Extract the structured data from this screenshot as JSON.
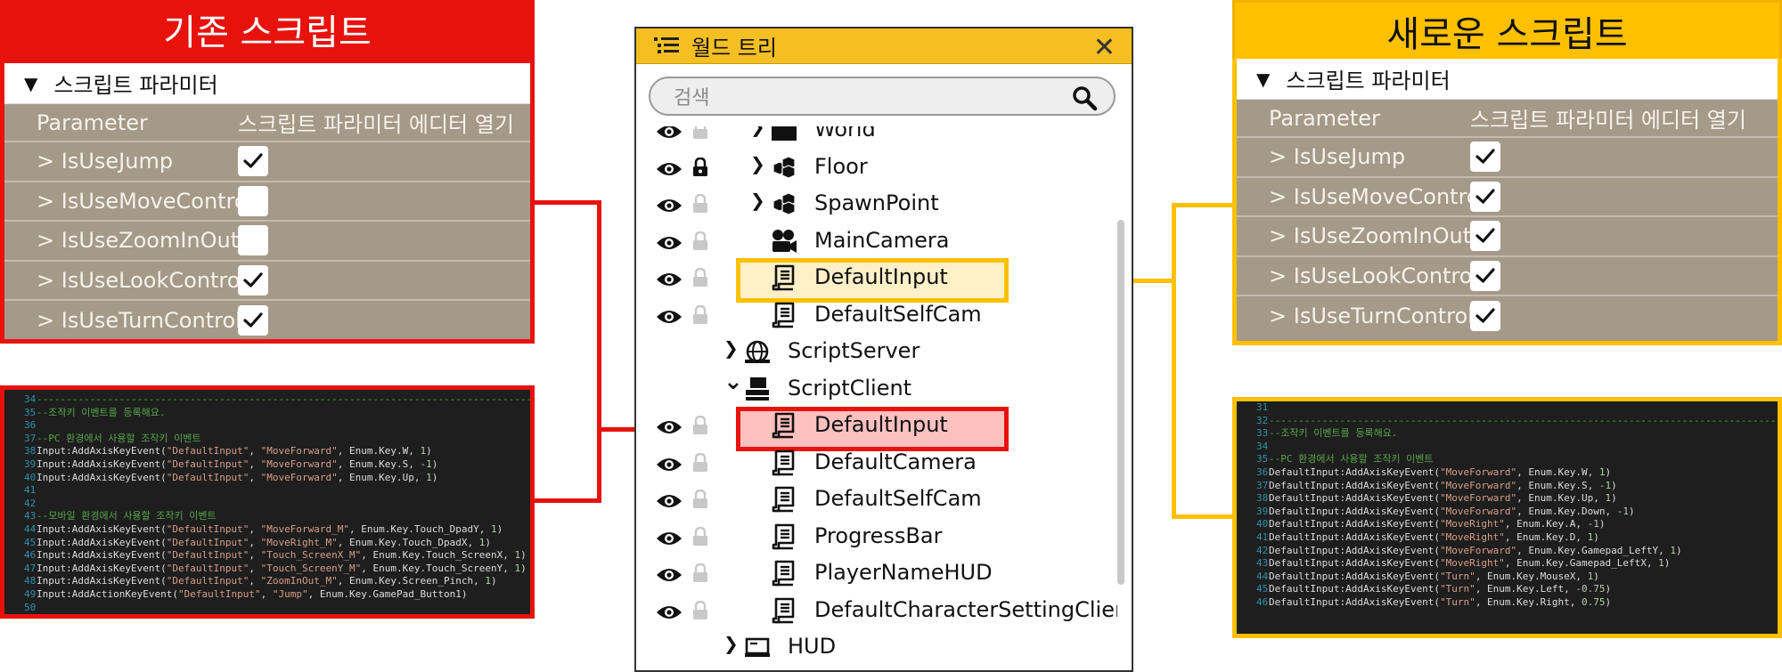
{
  "colors": {
    "old_accent": "#e8120c",
    "new_accent": "#ffc000",
    "panel_bg": "#a5998a",
    "code_bg": "#1e1e1e"
  },
  "old_section": {
    "banner": "기존 스크립트",
    "header": "스크립트 파라미터",
    "col_param": "Parameter",
    "col_editor": "스크립트 파라미터 에디터 열기",
    "params": [
      {
        "name": "> IsUseJump",
        "checked": true
      },
      {
        "name": "> IsUseMoveControl",
        "checked": false
      },
      {
        "name": "> IsUseZoomInOut",
        "checked": false
      },
      {
        "name": "> IsUseLookControl",
        "checked": true
      },
      {
        "name": "> IsUseTurnControl",
        "checked": true
      }
    ]
  },
  "new_section": {
    "banner": "새로운 스크립트",
    "header": "스크립트 파라미터",
    "col_param": "Parameter",
    "col_editor": "스크립트 파라미터 에디터 열기",
    "params": [
      {
        "name": "> IsUseJump",
        "checked": true
      },
      {
        "name": "> IsUseMoveControl",
        "checked": true
      },
      {
        "name": "> IsUseZoomInOut",
        "checked": true
      },
      {
        "name": "> IsUseLookControl",
        "checked": true
      },
      {
        "name": "> IsUseTurnControl",
        "checked": true
      }
    ]
  },
  "old_code": [
    {
      "n": "34",
      "parts": [
        [
          "cm",
          "-----------------------------------------------------------------------------------------"
        ]
      ]
    },
    {
      "n": "35",
      "parts": [
        [
          "cm",
          "--조작키 이벤트를 등록해요."
        ]
      ]
    },
    {
      "n": "36",
      "parts": []
    },
    {
      "n": "37",
      "parts": [
        [
          "cm",
          "--PC 환경에서 사용할 조작키 이벤트"
        ]
      ]
    },
    {
      "n": "38",
      "parts": [
        [
          "tx",
          "Input:AddAxisKeyEvent("
        ],
        [
          "st",
          "\"DefaultInput\""
        ],
        [
          "tx",
          ", "
        ],
        [
          "st",
          "\"MoveForward\""
        ],
        [
          "tx",
          ", Enum.Key.W, "
        ],
        [
          "nm",
          "1"
        ],
        [
          "tx",
          ")"
        ]
      ]
    },
    {
      "n": "39",
      "parts": [
        [
          "tx",
          "Input:AddAxisKeyEvent("
        ],
        [
          "st",
          "\"DefaultInput\""
        ],
        [
          "tx",
          ", "
        ],
        [
          "st",
          "\"MoveForward\""
        ],
        [
          "tx",
          ", Enum.Key.S, "
        ],
        [
          "nm",
          "-1"
        ],
        [
          "tx",
          ")"
        ]
      ]
    },
    {
      "n": "40",
      "parts": [
        [
          "tx",
          "Input:AddAxisKeyEvent("
        ],
        [
          "st",
          "\"DefaultInput\""
        ],
        [
          "tx",
          ", "
        ],
        [
          "st",
          "\"MoveForward\""
        ],
        [
          "tx",
          ", Enum.Key.Up, "
        ],
        [
          "nm",
          "1"
        ],
        [
          "tx",
          ")"
        ]
      ]
    },
    {
      "n": "41",
      "parts": []
    },
    {
      "n": "42",
      "parts": []
    },
    {
      "n": "43",
      "parts": [
        [
          "cm",
          "--모바일 환경에서 사용할 조작키 이벤트"
        ]
      ]
    },
    {
      "n": "44",
      "parts": [
        [
          "tx",
          "Input:AddAxisKeyEvent("
        ],
        [
          "st",
          "\"DefaultInput\""
        ],
        [
          "tx",
          ", "
        ],
        [
          "st",
          "\"MoveForward_M\""
        ],
        [
          "tx",
          ", Enum.Key.Touch_DpadY, "
        ],
        [
          "nm",
          "1"
        ],
        [
          "tx",
          ")"
        ]
      ]
    },
    {
      "n": "45",
      "parts": [
        [
          "tx",
          "Input:AddAxisKeyEvent("
        ],
        [
          "st",
          "\"DefaultInput\""
        ],
        [
          "tx",
          ", "
        ],
        [
          "st",
          "\"MoveRight_M\""
        ],
        [
          "tx",
          ", Enum.Key.Touch_DpadX, "
        ],
        [
          "nm",
          "1"
        ],
        [
          "tx",
          ")"
        ]
      ]
    },
    {
      "n": "46",
      "parts": [
        [
          "tx",
          "Input:AddAxisKeyEvent("
        ],
        [
          "st",
          "\"DefaultInput\""
        ],
        [
          "tx",
          ", "
        ],
        [
          "st",
          "\"Touch_ScreenX_M\""
        ],
        [
          "tx",
          ", Enum.Key.Touch_ScreenX, "
        ],
        [
          "nm",
          "1"
        ],
        [
          "tx",
          ")"
        ]
      ]
    },
    {
      "n": "47",
      "parts": [
        [
          "tx",
          "Input:AddAxisKeyEvent("
        ],
        [
          "st",
          "\"DefaultInput\""
        ],
        [
          "tx",
          ", "
        ],
        [
          "st",
          "\"Touch_ScreenY_M\""
        ],
        [
          "tx",
          ", Enum.Key.Touch_ScreenY, "
        ],
        [
          "nm",
          "1"
        ],
        [
          "tx",
          ")"
        ]
      ]
    },
    {
      "n": "48",
      "parts": [
        [
          "tx",
          "Input:AddAxisKeyEvent("
        ],
        [
          "st",
          "\"DefaultInput\""
        ],
        [
          "tx",
          ", "
        ],
        [
          "st",
          "\"ZoomInOut_M\""
        ],
        [
          "tx",
          ", Enum.Key.Screen_Pinch, "
        ],
        [
          "nm",
          "1"
        ],
        [
          "tx",
          ")"
        ]
      ]
    },
    {
      "n": "49",
      "parts": [
        [
          "tx",
          "Input:AddActionKeyEvent("
        ],
        [
          "st",
          "\"DefaultInput\""
        ],
        [
          "tx",
          ", "
        ],
        [
          "st",
          "\"Jump\""
        ],
        [
          "tx",
          ", Enum.Key.GamePad_Button1)"
        ]
      ]
    },
    {
      "n": "50",
      "parts": []
    }
  ],
  "new_code": [
    {
      "n": "31",
      "parts": []
    },
    {
      "n": "32",
      "parts": [
        [
          "cm",
          "-----------------------------------------------------------------------------------------"
        ]
      ]
    },
    {
      "n": "33",
      "parts": [
        [
          "cm",
          "--조작키 이벤트를 등록해요."
        ]
      ]
    },
    {
      "n": "34",
      "parts": []
    },
    {
      "n": "35",
      "parts": [
        [
          "cm",
          "--PC 환경에서 사용할 조작키 이벤트"
        ]
      ]
    },
    {
      "n": "36",
      "parts": [
        [
          "tx",
          "DefaultInput:AddAxisKeyEvent("
        ],
        [
          "st",
          "\"MoveForward\""
        ],
        [
          "tx",
          ", Enum.Key.W, "
        ],
        [
          "nm",
          "1"
        ],
        [
          "tx",
          ")"
        ]
      ]
    },
    {
      "n": "37",
      "parts": [
        [
          "tx",
          "DefaultInput:AddAxisKeyEvent("
        ],
        [
          "st",
          "\"MoveForward\""
        ],
        [
          "tx",
          ", Enum.Key.S, "
        ],
        [
          "nm",
          "-1"
        ],
        [
          "tx",
          ")"
        ]
      ]
    },
    {
      "n": "38",
      "parts": [
        [
          "tx",
          "DefaultInput:AddAxisKeyEvent("
        ],
        [
          "st",
          "\"MoveForward\""
        ],
        [
          "tx",
          ", Enum.Key.Up, "
        ],
        [
          "nm",
          "1"
        ],
        [
          "tx",
          ")"
        ]
      ]
    },
    {
      "n": "39",
      "parts": [
        [
          "tx",
          "DefaultInput:AddAxisKeyEvent("
        ],
        [
          "st",
          "\"MoveForward\""
        ],
        [
          "tx",
          ", Enum.Key.Down, "
        ],
        [
          "nm",
          "-1"
        ],
        [
          "tx",
          ")"
        ]
      ]
    },
    {
      "n": "40",
      "parts": [
        [
          "tx",
          "DefaultInput:AddAxisKeyEvent("
        ],
        [
          "st",
          "\"MoveRight\""
        ],
        [
          "tx",
          ", Enum.Key.A, "
        ],
        [
          "nm",
          "-1"
        ],
        [
          "tx",
          ")"
        ]
      ]
    },
    {
      "n": "41",
      "parts": [
        [
          "tx",
          "DefaultInput:AddAxisKeyEvent("
        ],
        [
          "st",
          "\"MoveRight\""
        ],
        [
          "tx",
          ", Enum.Key.D, "
        ],
        [
          "nm",
          "1"
        ],
        [
          "tx",
          ")"
        ]
      ]
    },
    {
      "n": "42",
      "parts": [
        [
          "tx",
          "DefaultInput:AddAxisKeyEvent("
        ],
        [
          "st",
          "\"MoveForward\""
        ],
        [
          "tx",
          ", Enum.Key.Gamepad_LeftY, "
        ],
        [
          "nm",
          "1"
        ],
        [
          "tx",
          ")"
        ]
      ]
    },
    {
      "n": "43",
      "parts": [
        [
          "tx",
          "DefaultInput:AddAxisKeyEvent("
        ],
        [
          "st",
          "\"MoveRight\""
        ],
        [
          "tx",
          ", Enum.Key.Gamepad_LeftX, "
        ],
        [
          "nm",
          "1"
        ],
        [
          "tx",
          ")"
        ]
      ]
    },
    {
      "n": "44",
      "parts": [
        [
          "tx",
          "DefaultInput:AddAxisKeyEvent("
        ],
        [
          "st",
          "\"Turn\""
        ],
        [
          "tx",
          ", Enum.Key.MouseX, "
        ],
        [
          "nm",
          "1"
        ],
        [
          "tx",
          ")"
        ]
      ]
    },
    {
      "n": "45",
      "parts": [
        [
          "tx",
          "DefaultInput:AddAxisKeyEvent("
        ],
        [
          "st",
          "\"Turn\""
        ],
        [
          "tx",
          ", Enum.Key.Left, "
        ],
        [
          "nm",
          "-0.75"
        ],
        [
          "tx",
          ")"
        ]
      ]
    },
    {
      "n": "46",
      "parts": [
        [
          "tx",
          "DefaultInput:AddAxisKeyEvent("
        ],
        [
          "st",
          "\"Turn\""
        ],
        [
          "tx",
          ", Enum.Key.Right, "
        ],
        [
          "nm",
          "0.75"
        ],
        [
          "tx",
          ")"
        ]
      ]
    }
  ],
  "world_tree": {
    "title": "월드 트리",
    "search_placeholder": "검색",
    "items": [
      {
        "label": "World",
        "icon": "folder-icon",
        "arrow": "▸",
        "eye": true,
        "lock": "open",
        "level": 1
      },
      {
        "label": "Floor",
        "icon": "cubes-icon",
        "arrow": "›",
        "eye": true,
        "lock": "closed",
        "level": 1
      },
      {
        "label": "SpawnPoint",
        "icon": "cubes-icon",
        "arrow": "›",
        "eye": true,
        "lock": "open",
        "level": 1
      },
      {
        "label": "MainCamera",
        "icon": "camera-icon",
        "arrow": "",
        "eye": true,
        "lock": "open",
        "level": 1
      },
      {
        "label": "DefaultInput",
        "icon": "script-icon",
        "arrow": "",
        "eye": true,
        "lock": "open",
        "level": 1
      },
      {
        "label": "DefaultSelfCam",
        "icon": "script-icon",
        "arrow": "",
        "eye": true,
        "lock": "open",
        "level": 1
      },
      {
        "label": "ScriptServer",
        "icon": "server-icon",
        "arrow": "›",
        "eye": false,
        "lock": "none",
        "level": 0
      },
      {
        "label": "ScriptClient",
        "icon": "client-icon",
        "arrow": "⌄",
        "eye": false,
        "lock": "none",
        "level": 0
      },
      {
        "label": "DefaultInput",
        "icon": "script-icon",
        "arrow": "",
        "eye": true,
        "lock": "open",
        "level": 1
      },
      {
        "label": "DefaultCamera",
        "icon": "script-icon",
        "arrow": "",
        "eye": true,
        "lock": "open",
        "level": 1
      },
      {
        "label": "DefaultSelfCam",
        "icon": "script-icon",
        "arrow": "",
        "eye": true,
        "lock": "open",
        "level": 1
      },
      {
        "label": "ProgressBar",
        "icon": "script-icon",
        "arrow": "",
        "eye": true,
        "lock": "open",
        "level": 1
      },
      {
        "label": "PlayerNameHUD",
        "icon": "script-icon",
        "arrow": "",
        "eye": true,
        "lock": "open",
        "level": 1
      },
      {
        "label": "DefaultCharacterSettingClient",
        "icon": "script-icon",
        "arrow": "",
        "eye": true,
        "lock": "open",
        "level": 1
      },
      {
        "label": "HUD",
        "icon": "hud-icon",
        "arrow": "›",
        "eye": false,
        "lock": "none",
        "level": 0
      }
    ]
  }
}
